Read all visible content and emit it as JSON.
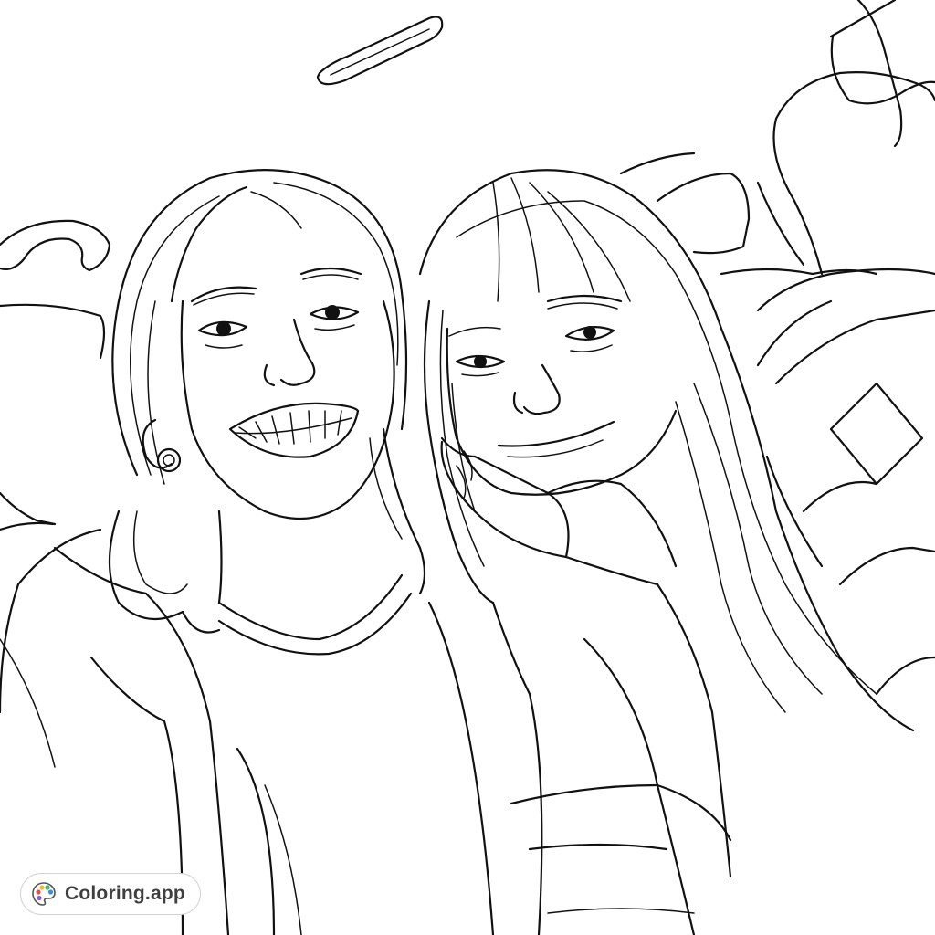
{
  "brand": {
    "label": "Coloring.app",
    "icon": "palette-icon",
    "palette_colors": [
      "#e94b4b",
      "#f5b82e",
      "#42b66f",
      "#3d8be8",
      "#9b59d0"
    ]
  },
  "artwork": {
    "style": "black line art coloring page",
    "line_color": "#111111",
    "background_color": "#ffffff"
  }
}
